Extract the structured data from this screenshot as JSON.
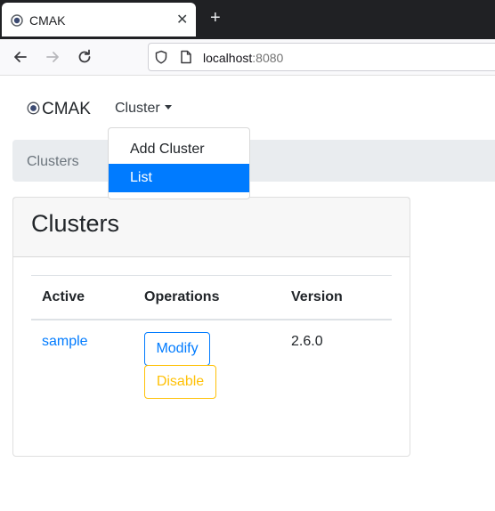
{
  "browser": {
    "tab_title": "CMAK",
    "tab_close_icon": "close-icon",
    "new_tab_label": "+",
    "url_host": "localhost",
    "url_port": ":8080"
  },
  "navbar": {
    "brand": "CMAK",
    "menu_label": "Cluster"
  },
  "breadcrumb": {
    "items": [
      "Clusters"
    ]
  },
  "dropdown": {
    "items": [
      "Add Cluster",
      "List"
    ]
  },
  "card": {
    "title": "Clusters",
    "table": {
      "headers": [
        "Active",
        "Operations",
        "Version"
      ],
      "rows": [
        {
          "name": "sample",
          "operations": [
            "Modify",
            "Disable"
          ],
          "version": "2.6.0"
        }
      ]
    }
  },
  "colors": {
    "primary": "#007bff",
    "warning": "#ffc107",
    "breadcrumb_bg": "#e9ecef"
  }
}
